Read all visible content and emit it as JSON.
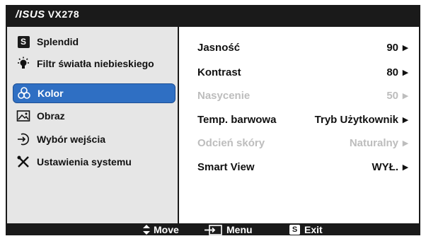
{
  "header": {
    "brand": "/ISUS",
    "model": "VX278"
  },
  "sidebar": {
    "items": [
      {
        "label": "Splendid",
        "icon": "splendid-s-icon"
      },
      {
        "label": "Filtr światła niebieskiego",
        "icon": "lightbulb-icon"
      },
      {
        "label": "Kolor",
        "icon": "color-circles-icon",
        "selected": true
      },
      {
        "label": "Obraz",
        "icon": "image-icon"
      },
      {
        "label": "Wybór wejścia",
        "icon": "input-arrow-icon"
      },
      {
        "label": "Ustawienia systemu",
        "icon": "tools-icon"
      }
    ]
  },
  "settings": [
    {
      "label": "Jasność",
      "value": "90",
      "enabled": true
    },
    {
      "label": "Kontrast",
      "value": "80",
      "enabled": true
    },
    {
      "label": "Nasycenie",
      "value": "50",
      "enabled": false
    },
    {
      "label": "Temp. barwowa",
      "value": "Tryb Użytkownik",
      "enabled": true
    },
    {
      "label": "Odcień skóry",
      "value": "Naturalny",
      "enabled": false
    },
    {
      "label": "Smart View",
      "value": "WYŁ.",
      "enabled": true
    }
  ],
  "footer": {
    "move": "Move",
    "menu": "Menu",
    "exit": "Exit",
    "exit_key": "S"
  },
  "colors": {
    "accent": "#2f6fc3",
    "frame": "#1a1a1a",
    "panel": "#e6e6e6",
    "disabled": "#bdbdbd"
  }
}
